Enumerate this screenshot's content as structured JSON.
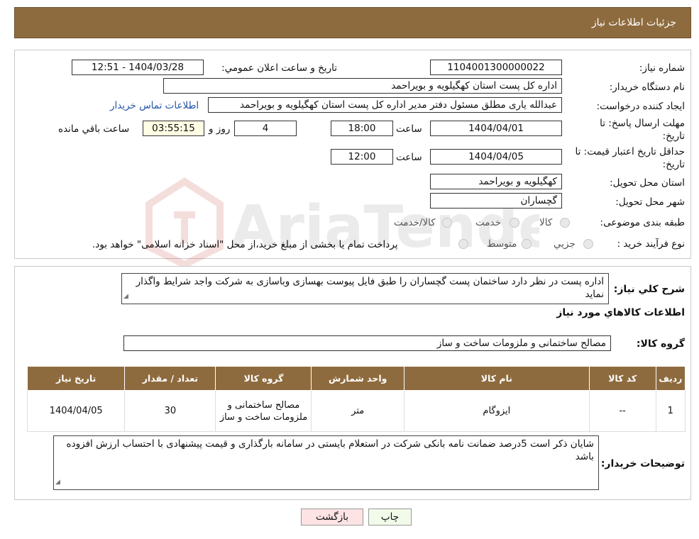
{
  "header": {
    "title": "جزئیات اطلاعات نیاز"
  },
  "form": {
    "need_number_label": "شماره نیاز:",
    "need_number": "1104001300000022",
    "announce_label": "تاریخ و ساعت اعلان عمومي:",
    "announce_value": "1404/03/28 - 12:51",
    "buyer_org_label": "نام دستگاه خریدار:",
    "buyer_org": "اداره کل پست استان کهگیلویه و بویراحمد",
    "requester_label": "ایجاد کننده درخواست:",
    "requester": "عبدالله یاری مطلق مسئول دفتر مدیر اداره کل پست استان کهگیلویه و بویراحمد",
    "contact_link": "اطلاعات تماس خریدار",
    "deadline_label": "مهلت ارسال پاسخ: تا تاریخ:",
    "deadline_date": "1404/04/01",
    "time_label": "ساعت",
    "deadline_time": "18:00",
    "days_value": "4",
    "days_label": "روز و",
    "remaining_time": "03:55:15",
    "remaining_label": "ساعت باقي مانده",
    "validity_label": "حداقل تاریخ اعتبار قیمت: تا تاریخ:",
    "validity_date": "1404/04/05",
    "validity_time": "12:00",
    "province_label": "استان محل تحویل:",
    "province": "کهگیلویه و بویراحمد",
    "city_label": "شهر محل تحویل:",
    "city": "گچساران",
    "category_label": "طبقه بندی موضوعی:",
    "category_options": [
      "کالا",
      "خدمت",
      "کالا/خدمت"
    ],
    "process_label": "نوع فرآیند خرید :",
    "process_options": [
      "جزیي",
      "متوسط"
    ],
    "process_note": "پرداخت تمام یا بخشی از مبلغ خرید،از محل \"اسناد خزانه اسلامی\" خواهد بود."
  },
  "description": {
    "label": "شرح کلي نیاز:",
    "text": "اداره پست در نظر دارد ساختمان  پست گچساران را طبق فایل پیوست بهسازی وباسازی  به شرکت واجد شرایط واگذار نماید"
  },
  "items_section": {
    "title": "اطلاعات کالاهاي مورد نیاز",
    "group_label": "گروه کالا:",
    "group_value": "مصالح ساختمانی و ملزومات ساخت و ساز",
    "columns": [
      "ردیف",
      "کد کالا",
      "نام کالا",
      "واحد شمارش",
      "گروه کالا",
      "تعداد / مقدار",
      "تاریخ نیاز"
    ],
    "rows": [
      {
        "row": "1",
        "code": "--",
        "name": "ایزوگام",
        "unit": "متر",
        "group": "مصالح ساختمانی و ملزومات ساخت و ساز",
        "qty": "30",
        "date": "1404/04/05"
      }
    ]
  },
  "buyer_notes": {
    "label": "توضیحات خریدار:",
    "text": "شایان ذکر است  5درصد ضمانت نامه بانکی  شرکت در استعلام  بایستی در سامانه بارگذاری و قیمت پیشنهادی  با احتساب ارزش افزوده باشد"
  },
  "buttons": {
    "print": "چاپ",
    "back": "بازگشت"
  },
  "watermark": {
    "text": "AriaTender.neT"
  },
  "colors": {
    "header_bg": "#8e6b3e",
    "link": "#2255aa",
    "print_bg": "#f2fbe9",
    "back_bg": "#fde3e3"
  }
}
